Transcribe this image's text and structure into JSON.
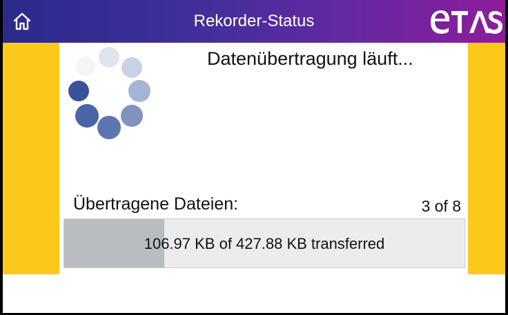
{
  "header": {
    "title": "Rekorder-Status",
    "home_icon": "home-icon",
    "logo_text": "ETAS",
    "colors": {
      "gradient_start": "#2b2a8a",
      "gradient_end": "#8e1c9c"
    }
  },
  "theme": {
    "side_color": "#fcc91b",
    "spinner_color": "#3a5a9c"
  },
  "status": {
    "message": "Datenübertragung läuft...",
    "spinner_icon": "loading-spinner-icon"
  },
  "files": {
    "label": "Übertragene Dateien:",
    "count": "3 of 8"
  },
  "progress": {
    "text": "106.97 KB of 427.88 KB transferred",
    "fraction": 0.25
  }
}
